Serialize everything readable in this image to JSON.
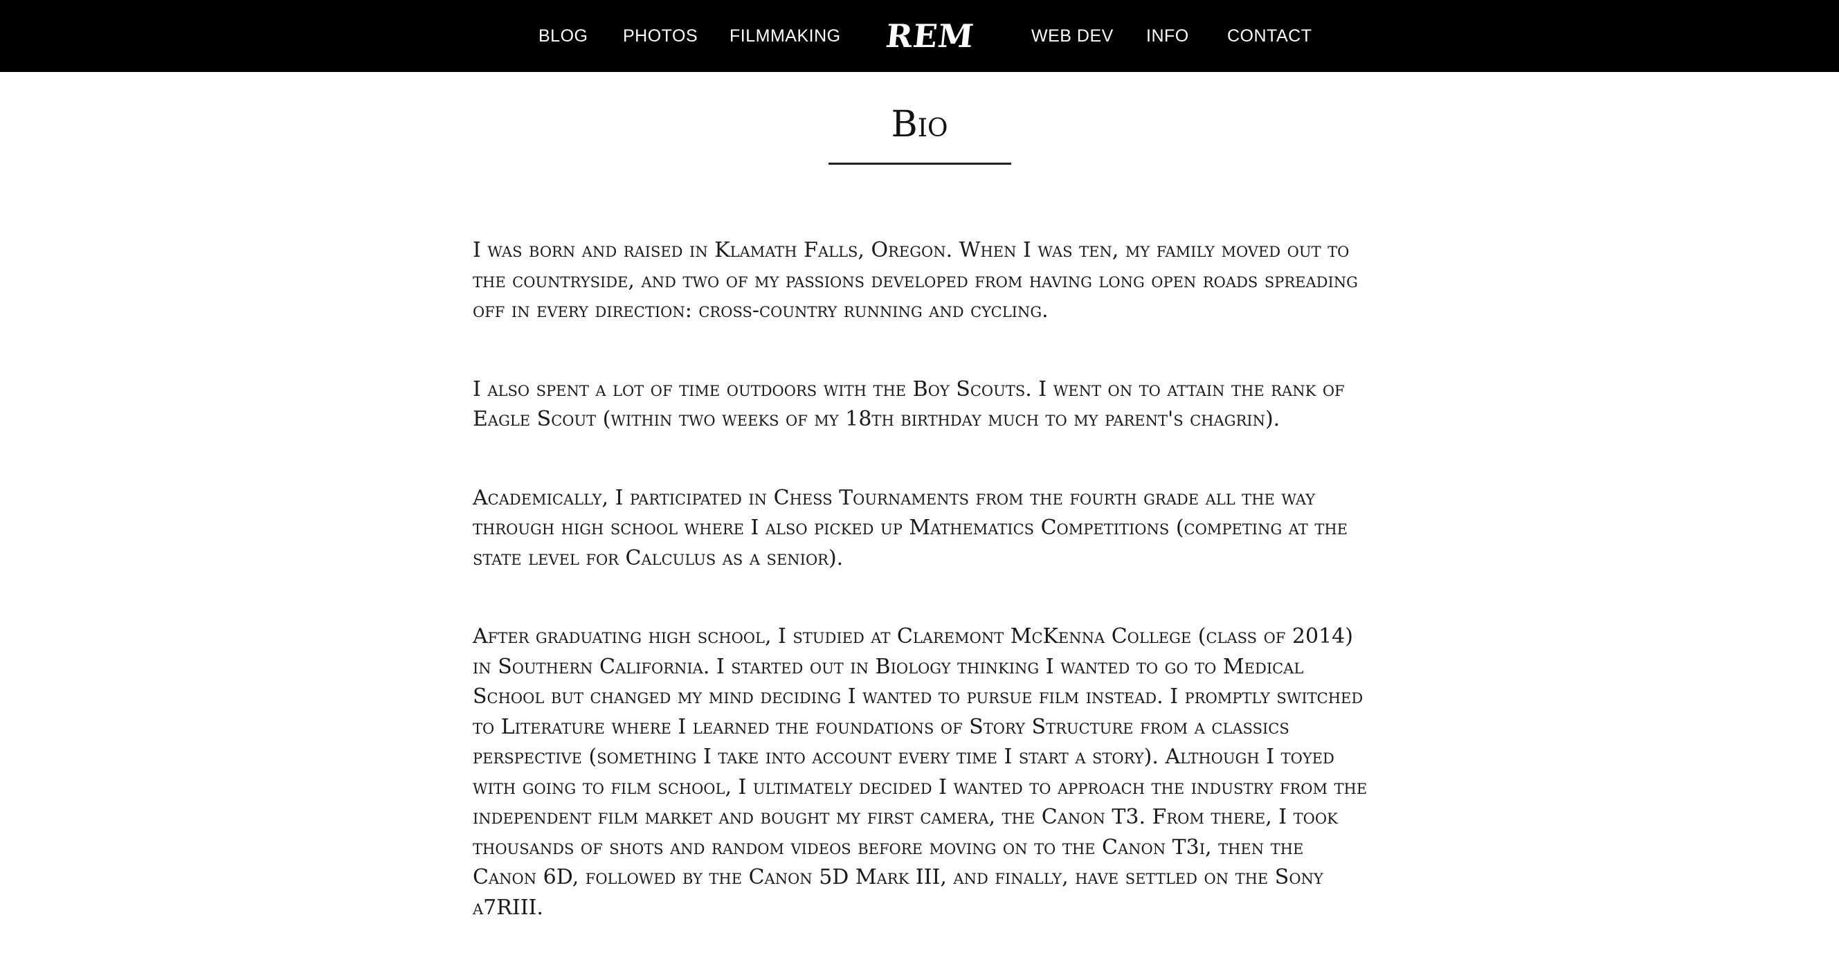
{
  "nav": {
    "left": [
      "BLOG",
      "PHOTOS",
      "FILMMAKING"
    ],
    "logo": "REM",
    "right": [
      "WEB DEV",
      "INFO",
      "CONTACT"
    ]
  },
  "page": {
    "title": "Bio"
  },
  "bio": {
    "paragraphs": [
      "I was born and raised in Klamath Falls, Oregon. When I was ten, my family moved out to the countryside, and two of my passions developed from having long open roads spreading off in every direction: cross-country running and cycling.",
      "I also spent a lot of time outdoors with the Boy Scouts. I went on to attain the rank of Eagle Scout (within two weeks of my 18th birthday much to my parent's chagrin).",
      "Academically, I participated in Chess Tournaments from the fourth grade all the way through high school where I also picked up Mathematics Competitions (competing at the state level for Calculus as a senior).",
      "After graduating high school, I studied at Claremont McKenna College (class of 2014) in Southern California. I started out in Biology thinking I wanted to go to Medical School but changed my mind deciding I wanted to pursue film instead. I promptly switched to Literature where I learned the foundations of Story Structure from a classics perspective (something I take into account every time I start a story). Although I toyed with going to film school, I ultimately decided I wanted to approach the industry from the independent film market and bought my first camera, the Canon T3. From there, I took thousands of shots and random videos before moving on to the Canon T3i, then the Canon 6D, followed by the Canon 5D Mark III, and finally, have settled on the Sony a7RIII."
    ]
  }
}
